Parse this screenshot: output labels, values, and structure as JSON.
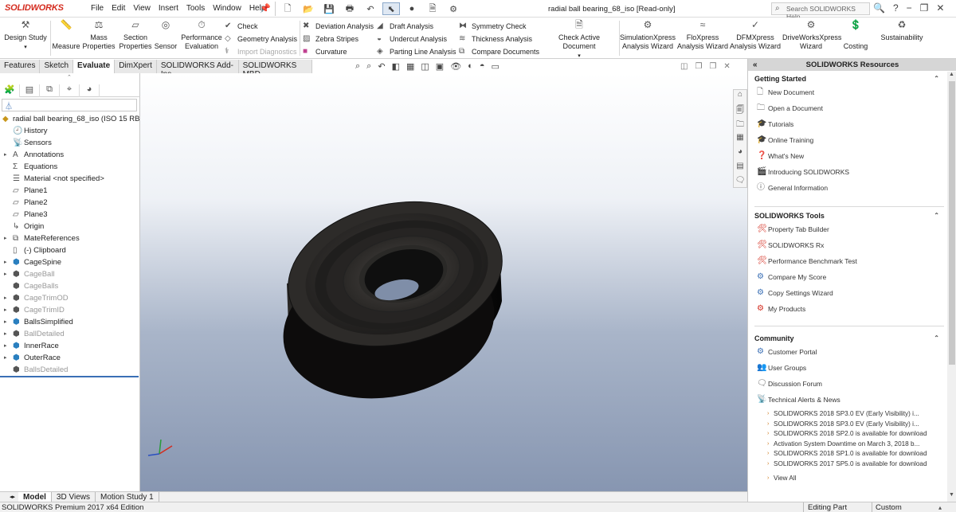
{
  "app": {
    "logo": "SOLIDWORKS",
    "menus": [
      "File",
      "Edit",
      "View",
      "Insert",
      "Tools",
      "Window",
      "Help"
    ],
    "document_title": "radial ball bearing_68_iso [Read-only]",
    "search_placeholder": "Search SOLIDWORKS Help"
  },
  "ribbon": {
    "design_study": "Design Study",
    "measure": "Measure",
    "mass_properties": [
      "Mass",
      "Properties"
    ],
    "section_properties": [
      "Section",
      "Properties"
    ],
    "sensor": "Sensor",
    "performance_evaluation": [
      "Performance",
      "Evaluation"
    ],
    "check": "Check",
    "geometry_analysis": "Geometry Analysis",
    "import_diagnostics": "Import Diagnostics",
    "deviation_analysis": "Deviation Analysis",
    "zebra_stripes": "Zebra Stripes",
    "curvature": "Curvature",
    "draft_analysis": "Draft Analysis",
    "undercut_analysis": "Undercut Analysis",
    "parting_line_analysis": "Parting Line Analysis",
    "symmetry_check": "Symmetry Check",
    "thickness_analysis": "Thickness Analysis",
    "compare_documents": "Compare Documents",
    "check_active_document": "Check Active Document",
    "simulationxpress": [
      "SimulationXpress",
      "Analysis Wizard"
    ],
    "floxpress": [
      "FloXpress",
      "Analysis Wizard"
    ],
    "dfmxpress": [
      "DFMXpress",
      "Analysis Wizard"
    ],
    "driveworksxpress": [
      "DriveWorksXpress",
      "Wizard"
    ],
    "costing": "Costing",
    "sustainability": "Sustainability"
  },
  "tabs": [
    "Features",
    "Sketch",
    "Evaluate",
    "DimXpert",
    "SOLIDWORKS Add-Ins",
    "SOLIDWORKS MBD"
  ],
  "active_tab": "Evaluate",
  "feature_tree": {
    "root": "radial ball bearing_68_iso  (ISO 15 RBB",
    "items": [
      {
        "label": "History",
        "arrow": "",
        "gray": false
      },
      {
        "label": "Sensors",
        "arrow": "",
        "gray": false
      },
      {
        "label": "Annotations",
        "arrow": "▸",
        "gray": false
      },
      {
        "label": "Equations",
        "arrow": "",
        "gray": false
      },
      {
        "label": "Material <not specified>",
        "arrow": "",
        "gray": false
      },
      {
        "label": "Plane1",
        "arrow": "",
        "gray": false
      },
      {
        "label": "Plane2",
        "arrow": "",
        "gray": false
      },
      {
        "label": "Plane3",
        "arrow": "",
        "gray": false
      },
      {
        "label": "Origin",
        "arrow": "",
        "gray": false
      },
      {
        "label": "MateReferences",
        "arrow": "▸",
        "gray": false
      },
      {
        "label": "(-) Clipboard",
        "arrow": "",
        "gray": false
      },
      {
        "label": "CageSpine",
        "arrow": "▸",
        "gray": false
      },
      {
        "label": "CageBall",
        "arrow": "▸",
        "gray": true
      },
      {
        "label": "CageBalls",
        "arrow": "",
        "gray": true
      },
      {
        "label": "CageTrimOD",
        "arrow": "▸",
        "gray": true
      },
      {
        "label": "CageTrimID",
        "arrow": "▸",
        "gray": true
      },
      {
        "label": "BallsSimplified",
        "arrow": "▸",
        "gray": false
      },
      {
        "label": "BallDetailed",
        "arrow": "▸",
        "gray": true
      },
      {
        "label": "InnerRace",
        "arrow": "▸",
        "gray": false
      },
      {
        "label": "OuterRace",
        "arrow": "▸",
        "gray": false
      },
      {
        "label": "BallsDetailed",
        "arrow": "",
        "gray": true
      }
    ]
  },
  "bottom_tabs": [
    "Model",
    "3D Views",
    "Motion Study 1"
  ],
  "status": {
    "left": "SOLIDWORKS Premium 2017 x64 Edition",
    "editing": "Editing Part",
    "units": "Custom"
  },
  "resources": {
    "title": "SOLIDWORKS Resources",
    "getting_started": {
      "title": "Getting Started",
      "items": [
        "New Document",
        "Open a Document",
        "Tutorials",
        "Online Training",
        "What's New",
        "Introducing SOLIDWORKS",
        "General Information"
      ]
    },
    "tools": {
      "title": "SOLIDWORKS Tools",
      "items": [
        "Property Tab Builder",
        "SOLIDWORKS Rx",
        "Performance Benchmark Test",
        "Compare My Score",
        "Copy Settings Wizard",
        "My Products"
      ]
    },
    "community": {
      "title": "Community",
      "items": [
        "Customer Portal",
        "User Groups",
        "Discussion Forum",
        "Technical Alerts & News"
      ],
      "news": [
        "SOLIDWORKS 2018 SP3.0 EV (Early Visibility) i...",
        "SOLIDWORKS 2018 SP3.0 EV (Early Visibility) i...",
        "SOLIDWORKS 2018 SP2.0 is available for download",
        "Activation System Downtime on March 3, 2018 b...",
        "SOLIDWORKS 2018 SP1.0 is available for download",
        "SOLIDWORKS 2017 SP5.0 is available for download"
      ],
      "view_all": "View All"
    }
  },
  "colors": {
    "accent": "#d42b1e",
    "selection": "#3a6fb5",
    "viewport_bottom": "#8796b1"
  }
}
